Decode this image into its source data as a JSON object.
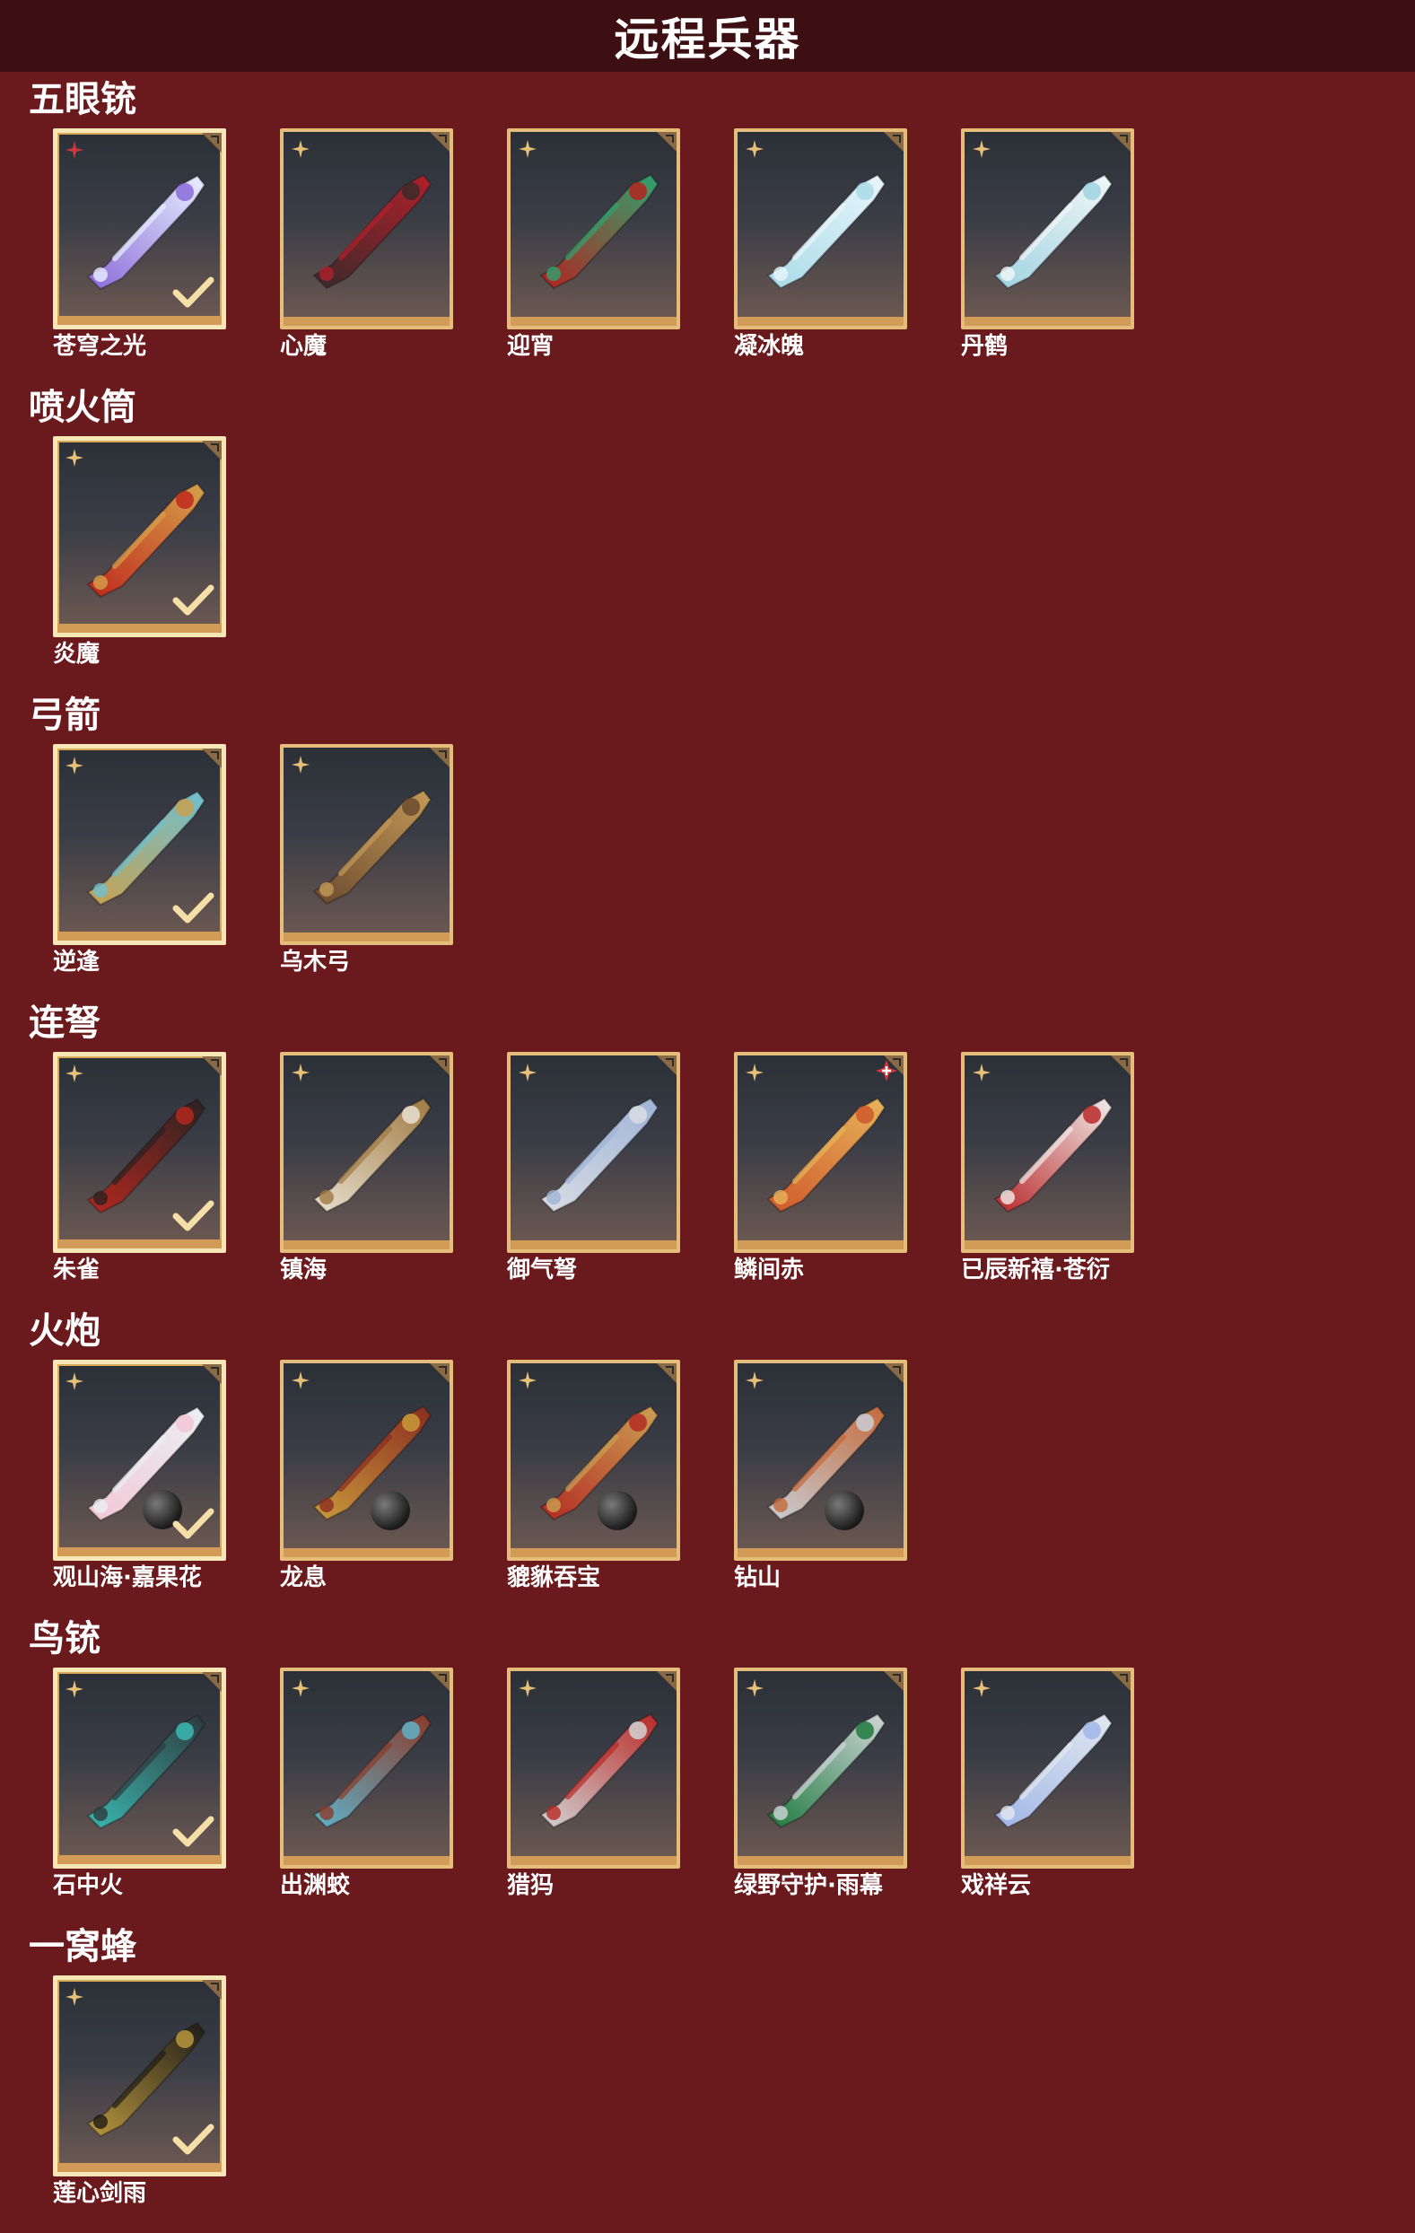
{
  "header": {
    "title": "远程兵器"
  },
  "colors": {
    "background": "#6a191d",
    "header_bar": "#3e0f12",
    "card_border": "#e4bd7a",
    "card_border_selected": "#f7e6b6",
    "rarity_gold": "#e7c077",
    "rarity_red": "#c8383c"
  },
  "sections": [
    {
      "title": "五眼铳",
      "items": [
        {
          "name": "苍穹之光",
          "selected": true,
          "rarity_icon": "red-star-icon",
          "palette": [
            "#8a6bd8",
            "#e8f0ff"
          ]
        },
        {
          "name": "心魔",
          "selected": false,
          "rarity_icon": "gold-star-icon",
          "palette": [
            "#3a2a2a",
            "#b0202a"
          ]
        },
        {
          "name": "迎宵",
          "selected": false,
          "rarity_icon": "gold-star-icon",
          "palette": [
            "#b3231f",
            "#2fa36e"
          ]
        },
        {
          "name": "凝冰魄",
          "selected": false,
          "rarity_icon": "gold-star-icon",
          "palette": [
            "#a8dbe8",
            "#e9f6fb"
          ]
        },
        {
          "name": "丹鹤",
          "selected": false,
          "rarity_icon": "gold-star-icon",
          "palette": [
            "#9fd3e2",
            "#f2f7f7"
          ]
        }
      ]
    },
    {
      "title": "喷火筒",
      "items": [
        {
          "name": "炎魔",
          "selected": true,
          "rarity_icon": "gold-star-icon",
          "palette": [
            "#c0281d",
            "#d6a24a"
          ]
        }
      ]
    },
    {
      "title": "弓箭",
      "items": [
        {
          "name": "逆逢",
          "selected": true,
          "rarity_icon": "gold-star-icon",
          "palette": [
            "#c9a14f",
            "#6ec0cf"
          ]
        },
        {
          "name": "乌木弓",
          "selected": false,
          "rarity_icon": "gold-star-icon",
          "palette": [
            "#6b4a2f",
            "#c49a57"
          ]
        }
      ]
    },
    {
      "title": "连弩",
      "items": [
        {
          "name": "朱雀",
          "selected": true,
          "rarity_icon": "gold-star-icon",
          "palette": [
            "#b3281f",
            "#2a2220"
          ]
        },
        {
          "name": "镇海",
          "selected": false,
          "rarity_icon": "gold-star-icon",
          "palette": [
            "#e8e0d0",
            "#a07a42"
          ]
        },
        {
          "name": "御气弩",
          "selected": false,
          "rarity_icon": "gold-star-icon",
          "palette": [
            "#d8dde3",
            "#9fb4d6"
          ]
        },
        {
          "name": "鳞间赤",
          "selected": false,
          "rarity_icon": "gold-star-icon",
          "palette": [
            "#d0582b",
            "#e7b45a"
          ],
          "badge": "red-plus-badge-icon"
        },
        {
          "name": "已辰新禧·苍衍",
          "selected": false,
          "rarity_icon": "gold-star-icon",
          "palette": [
            "#b82a2a",
            "#f1ecea"
          ]
        }
      ]
    },
    {
      "title": "火炮",
      "items": [
        {
          "name": "观山海·嘉果花",
          "selected": true,
          "rarity_icon": "gold-star-icon",
          "palette": [
            "#f2c6d4",
            "#eaf0f2"
          ],
          "ball": true
        },
        {
          "name": "龙息",
          "selected": false,
          "rarity_icon": "gold-star-icon",
          "palette": [
            "#c99a3a",
            "#8a2d20"
          ],
          "ball": true
        },
        {
          "name": "貔貅吞宝",
          "selected": false,
          "rarity_icon": "gold-star-icon",
          "palette": [
            "#b42a23",
            "#caa052"
          ],
          "ball": true
        },
        {
          "name": "钻山",
          "selected": false,
          "rarity_icon": "gold-star-icon",
          "palette": [
            "#c9ced6",
            "#c46a3a"
          ],
          "ball": true
        }
      ]
    },
    {
      "title": "鸟铳",
      "items": [
        {
          "name": "石中火",
          "selected": true,
          "rarity_icon": "gold-star-icon",
          "palette": [
            "#3ab8b0",
            "#2e3a3e"
          ]
        },
        {
          "name": "出渊蛟",
          "selected": false,
          "rarity_icon": "gold-star-icon",
          "palette": [
            "#5fb2c8",
            "#8a3b2a"
          ]
        },
        {
          "name": "猎犸",
          "selected": false,
          "rarity_icon": "gold-star-icon",
          "palette": [
            "#d2d4d6",
            "#b82a25"
          ]
        },
        {
          "name": "绿野守护·雨幕",
          "selected": false,
          "rarity_icon": "gold-star-icon",
          "palette": [
            "#1f7a3e",
            "#d0d6d8"
          ]
        },
        {
          "name": "戏祥云",
          "selected": false,
          "rarity_icon": "gold-star-icon",
          "palette": [
            "#9fb7e6",
            "#e3e8f0"
          ]
        }
      ]
    },
    {
      "title": "一窝蜂",
      "items": [
        {
          "name": "莲心剑雨",
          "selected": true,
          "rarity_icon": "gold-star-icon",
          "palette": [
            "#b8973d",
            "#1e1c18"
          ]
        }
      ]
    }
  ]
}
